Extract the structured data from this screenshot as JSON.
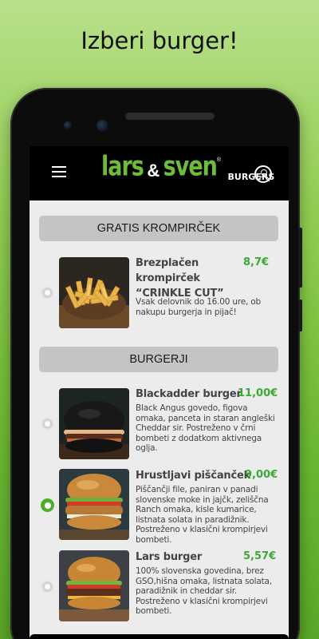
{
  "headline": "Izberi burger!",
  "app": {
    "logo_main": "lars",
    "logo_amp": "&",
    "logo_second": "sven",
    "logo_reg": "®",
    "logo_sub": "BURGERS"
  },
  "sections": [
    {
      "title": "GRATIS KROMPIRČEK",
      "items": [
        {
          "name_line1": "Brezplačen",
          "name_line2": "krompirček",
          "name_line3": "“CRINKLE CUT”",
          "price": "8,7€",
          "description": "Vsak delovnik do 16.00 ure, ob nakupu burgerja in pijač!",
          "selected": false,
          "image": "fries-photo"
        }
      ]
    },
    {
      "title": "BURGERJI",
      "items": [
        {
          "name_line1": "Blackadder burger",
          "price": "11,00€",
          "description": "Black Angus govedo, figova omaka, panceta in  staran angleški Cheddar sir.  Postreženo v črni bombeti z dodatkom aktivnega oglja.",
          "selected": false,
          "image": "black-bun-burger-photo"
        },
        {
          "name_line1": "Hrustljavi piščanček",
          "price": "9,00€",
          "description": "Piščančji file, paniran v panadi slovenske moke in jajčk, zeliščna Ranch omaka, kisle kumarice, listnata solata in paradižnik. Postreženo v klasični krompirjevi bombeti.",
          "selected": true,
          "image": "chicken-burger-photo"
        },
        {
          "name_line1": "Lars burger",
          "price": "5,57€",
          "description": "100% slovenska govedina, brez GSO,hišna omaka, listnata solata, paradižnik in cheddar sir. Postreženo v klasični krompirjevi bombeti.",
          "selected": false,
          "image": "beef-burger-photo"
        }
      ]
    }
  ]
}
